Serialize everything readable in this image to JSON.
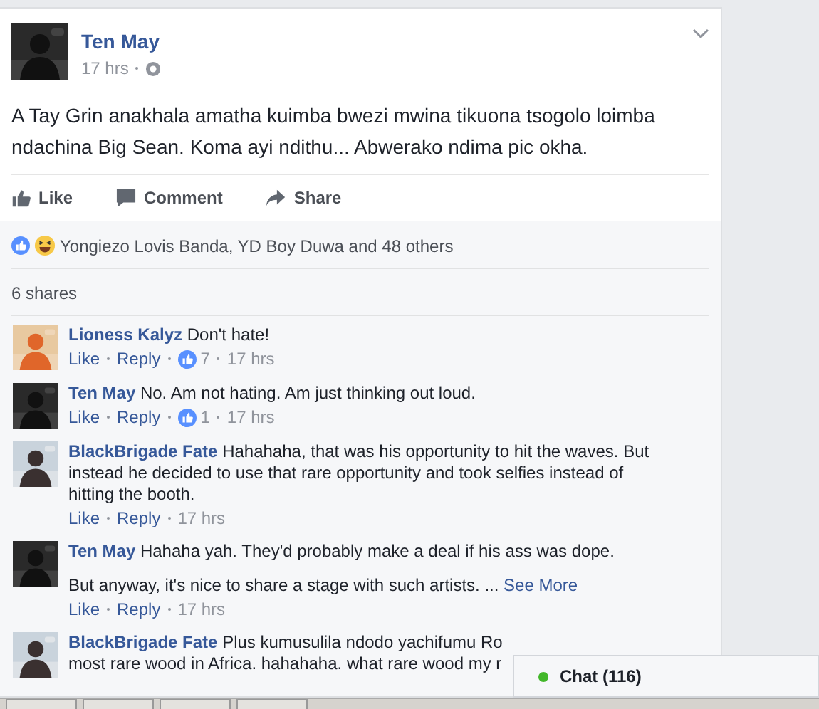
{
  "post": {
    "author": "Ten May",
    "time": "17 hrs",
    "text": "A Tay Grin anakhala amatha kuimba bwezi mwina tikuona tsogolo loimba ndachina Big Sean. Koma ayi ndithu... Abwerako ndima pic okha.",
    "actions": [
      "Like",
      "Comment",
      "Share"
    ],
    "reactions_text": "Yongiezo Lovis Banda, YD Boy Duwa and 48 others",
    "shares": "6 shares"
  },
  "comments": [
    {
      "author": "Lioness Kalyz",
      "text": "Don't hate!",
      "like": "Like",
      "reply": "Reply",
      "likes": "7",
      "time": "17 hrs"
    },
    {
      "author": "Ten May",
      "text": "No. Am not hating. Am just thinking out loud.",
      "like": "Like",
      "reply": "Reply",
      "likes": "1",
      "time": "17 hrs"
    },
    {
      "author": "BlackBrigade Fate",
      "text": "Hahahaha, that was his opportunity to hit the waves. But instead he decided to use that rare opportunity and took selfies instead of hitting the booth.",
      "like": "Like",
      "reply": "Reply",
      "time": "17 hrs"
    },
    {
      "author": "Ten May",
      "text": "Hahaha yah. They'd probably make a deal if his ass was dope.",
      "more_text": "But anyway, it's nice to share a stage with such artists. ...",
      "see_more": "See More",
      "like": "Like",
      "reply": "Reply",
      "time": "17 hrs"
    },
    {
      "author": "BlackBrigade Fate",
      "text": "Plus kumusulila ndodo yachifumu Ro",
      "text_line_2": "most rare wood in Africa. hahahaha. what rare wood my r"
    }
  ],
  "chat": {
    "label": "Chat (116)",
    "online": true
  }
}
